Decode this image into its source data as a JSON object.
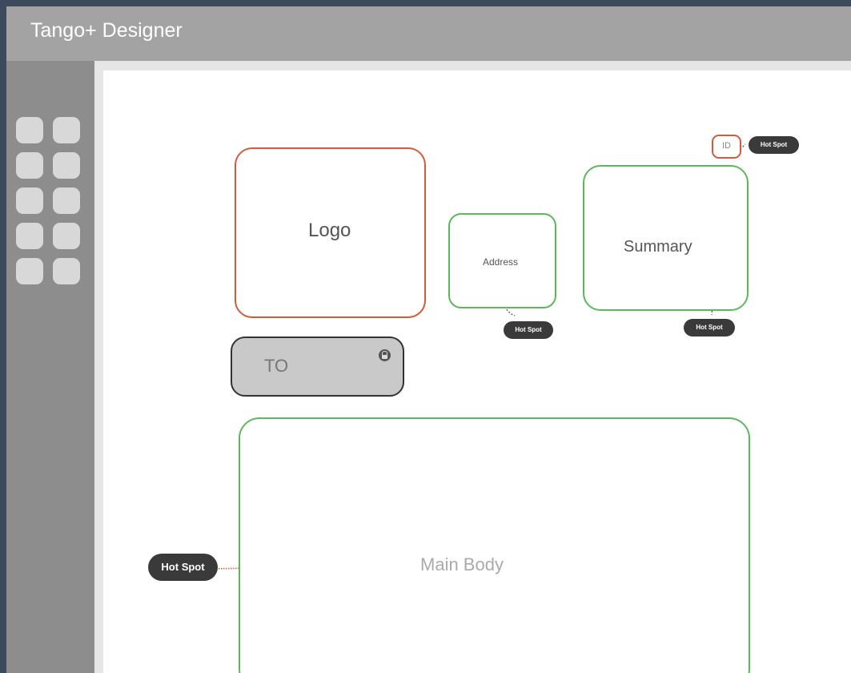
{
  "app": {
    "title": "Tango+ Designer"
  },
  "sidebar": {
    "tools": [
      "tool-1",
      "tool-2",
      "tool-3",
      "tool-4",
      "tool-5",
      "tool-6",
      "tool-7",
      "tool-8",
      "tool-9",
      "tool-10"
    ]
  },
  "canvas": {
    "logo": {
      "label": "Logo"
    },
    "address": {
      "label": "Address"
    },
    "summary": {
      "label": "Summary"
    },
    "id_field": {
      "label": "ID"
    },
    "to_field": {
      "label": "TO",
      "icon": "lock-icon"
    },
    "main_body": {
      "label": "Main Body"
    },
    "hotspots": {
      "address": "Hot Spot",
      "summary": "Hot Spot",
      "id": "Hot Spot",
      "main_body": "Hot Spot"
    }
  },
  "colors": {
    "editable_region": "#5cb85c",
    "image_region": "#d65a3a",
    "locked_region": "#c9c9c9",
    "hotspot_badge": "#3a3a3a",
    "titlebar": "#a3a3a3",
    "sidebar": "#8d8d8d"
  }
}
